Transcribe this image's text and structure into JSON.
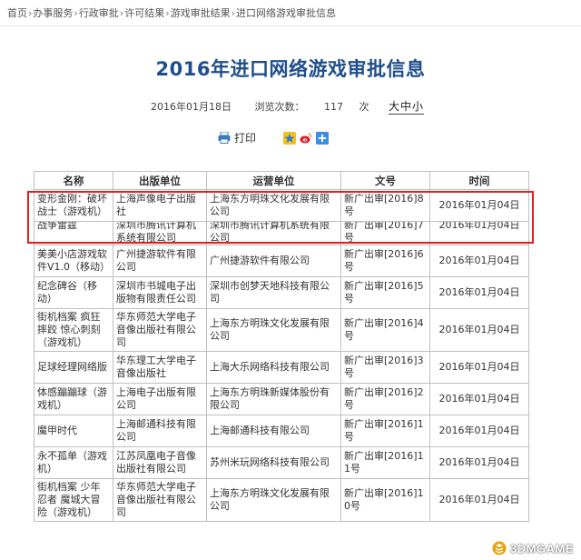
{
  "breadcrumb": [
    {
      "label": "首页"
    },
    {
      "label": "办事服务"
    },
    {
      "label": "行政审批"
    },
    {
      "label": "许可结果"
    },
    {
      "label": "游戏审批结果"
    },
    {
      "label": "进口网络游戏审批信息"
    }
  ],
  "breadcrumb_sep": "›",
  "page_title": "2016年进口网络游戏审批信息",
  "meta": {
    "date": "2016年01月18日",
    "views_label": "浏览次数：",
    "views": "117",
    "views_unit": "次",
    "font_large": "大",
    "font_medium": "中",
    "font_small": "小"
  },
  "toolbar": {
    "print_label": "打印",
    "share_icons": [
      "qzone-icon",
      "weibo-icon",
      "more-share-icon"
    ]
  },
  "table": {
    "headers": [
      "名称",
      "出版单位",
      "运营单位",
      "文号",
      "时间"
    ],
    "rows": [
      [
        "变形金刚：破坏战士（游戏机）",
        "上海声像电子出版社",
        "上海东方明珠文化发展有限公司",
        "新广出审[2016]8号",
        "2016年01月04日"
      ],
      [
        "战争雷霆",
        "深圳市腾讯计算机系统有限公司",
        "深圳市腾讯计算机系统有限公司",
        "新广出审[2016]7号",
        "2016年01月04日"
      ],
      [
        "美美小店游戏软件V1.0（移动）",
        "广州捷游软件有限公司",
        "广州捷游软件有限公司",
        "新广出审[2016]6号",
        "2016年01月04日"
      ],
      [
        "纪念碑谷（移动）",
        "深圳市书城电子出版物有限责任公司",
        "深圳市创梦天地科技有限公司",
        "新广出审[2016]5号",
        "2016年01月04日"
      ],
      [
        "街机档案 疯狂摔跤 惊心刺刻（游戏机）",
        "华东师范大学电子音像出版社有限公司",
        "上海东方明珠文化发展有限公司",
        "新广出审[2016]4号",
        "2016年01月04日"
      ],
      [
        "足球经理网络版",
        "华东理工大学电子音像出版社",
        "上海大乐网络科技有限公司",
        "新广出审[2016]3号",
        "2016年01月04日"
      ],
      [
        "体感蹦蹦球（游戏机）",
        "上海电子出版有限公司",
        "上海东方明珠新媒体股份有限公司",
        "新广出审[2016]2号",
        "2016年01月04日"
      ],
      [
        "魔甲时代",
        "上海邮通科技有限公司",
        "上海邮通科技有限公司",
        "新广出审[2016]1号",
        "2016年01月04日"
      ],
      [
        "永不孤单（游戏机）",
        "江苏凤凰电子音像出版社有限公司",
        "苏州米玩网络科技有限公司",
        "新广出审[2016]11号",
        "2016年01月04日"
      ],
      [
        "街机档案 少年忍者 魔城大冒险（游戏机）",
        "华东师范大学电子音像出版社有限公司",
        "上海东方明珠文化发展有限公司",
        "新广出审[2016]10号",
        "2016年01月04日"
      ]
    ]
  },
  "watermark": {
    "text": "3DMGAME",
    "accent": "#e8a200"
  },
  "colors": {
    "title": "#1f4e8c",
    "highlight": "#e02020",
    "border": "#bfbfbf"
  }
}
